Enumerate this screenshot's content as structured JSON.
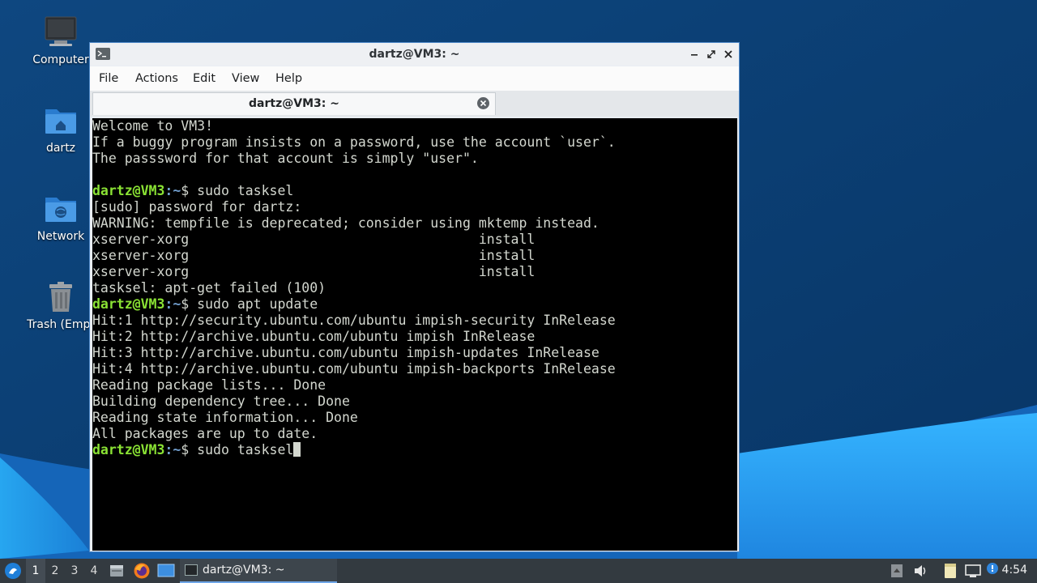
{
  "desktop": {
    "icons": [
      {
        "label": "Computer",
        "icon": "computer-icon"
      },
      {
        "label": "dartz",
        "icon": "home-folder-icon"
      },
      {
        "label": "Network",
        "icon": "network-folder-icon"
      },
      {
        "label": "Trash (Empt",
        "icon": "trash-icon"
      }
    ]
  },
  "window": {
    "title": "dartz@VM3: ~",
    "menu": [
      "File",
      "Actions",
      "Edit",
      "View",
      "Help"
    ],
    "tab_label": "dartz@VM3: ~"
  },
  "terminal": {
    "user_host": "dartz@VM3",
    "path": ":~",
    "lines": [
      {
        "type": "out",
        "text": "Welcome to VM3!"
      },
      {
        "type": "out",
        "text": "If a buggy program insists on a password, use the account `user`."
      },
      {
        "type": "out",
        "text": "The passsword for that account is simply \"user\"."
      },
      {
        "type": "out",
        "text": ""
      },
      {
        "type": "prompt",
        "text": "$ sudo tasksel"
      },
      {
        "type": "out",
        "text": "[sudo] password for dartz:"
      },
      {
        "type": "out",
        "text": "WARNING: tempfile is deprecated; consider using mktemp instead."
      },
      {
        "type": "out",
        "text": "xserver-xorg                                    install"
      },
      {
        "type": "out",
        "text": "xserver-xorg                                    install"
      },
      {
        "type": "out",
        "text": "xserver-xorg                                    install"
      },
      {
        "type": "out",
        "text": "tasksel: apt-get failed (100)"
      },
      {
        "type": "prompt",
        "text": "$ sudo apt update"
      },
      {
        "type": "out",
        "text": "Hit:1 http://security.ubuntu.com/ubuntu impish-security InRelease"
      },
      {
        "type": "out",
        "text": "Hit:2 http://archive.ubuntu.com/ubuntu impish InRelease"
      },
      {
        "type": "out",
        "text": "Hit:3 http://archive.ubuntu.com/ubuntu impish-updates InRelease"
      },
      {
        "type": "out",
        "text": "Hit:4 http://archive.ubuntu.com/ubuntu impish-backports InRelease"
      },
      {
        "type": "out",
        "text": "Reading package lists... Done"
      },
      {
        "type": "out",
        "text": "Building dependency tree... Done"
      },
      {
        "type": "out",
        "text": "Reading state information... Done"
      },
      {
        "type": "out",
        "text": "All packages are up to date."
      },
      {
        "type": "prompt",
        "text": "$ sudo tasksel",
        "cursor": true
      }
    ]
  },
  "taskbar": {
    "workspaces": [
      "1",
      "2",
      "3",
      "4"
    ],
    "active_workspace": "1",
    "task_label": "dartz@VM3: ~",
    "clock": "4:54"
  },
  "colors": {
    "prompt_user": "#8ae234",
    "prompt_path": "#729fcf",
    "terminal_bg": "#000000",
    "terminal_fg": "#d3d7cf",
    "window_border": "#4d87c7",
    "taskbar_bg": "#333a40"
  }
}
